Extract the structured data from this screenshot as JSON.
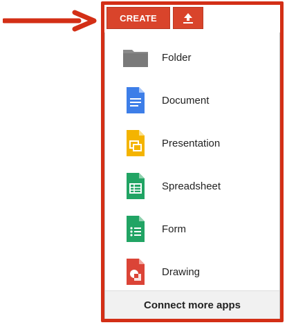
{
  "toolbar": {
    "create_label": "CREATE"
  },
  "menu": {
    "items": [
      {
        "label": "Folder",
        "icon": "folder-icon",
        "color": "#8a8a8a"
      },
      {
        "label": "Document",
        "icon": "document-icon",
        "color": "#3d7ee8"
      },
      {
        "label": "Presentation",
        "icon": "presentation-icon",
        "color": "#f4b400"
      },
      {
        "label": "Spreadsheet",
        "icon": "spreadsheet-icon",
        "color": "#21a464"
      },
      {
        "label": "Form",
        "icon": "form-icon",
        "color": "#21a464"
      },
      {
        "label": "Drawing",
        "icon": "drawing-icon",
        "color": "#db4437"
      }
    ]
  },
  "footer": {
    "connect_label": "Connect more apps"
  },
  "colors": {
    "accent": "#d9442b",
    "highlight": "#d32f16"
  }
}
